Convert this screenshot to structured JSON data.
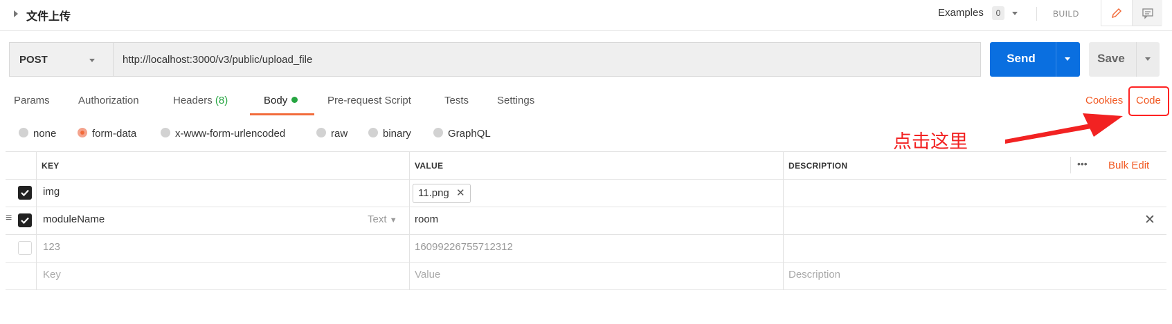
{
  "header": {
    "title": "文件上传",
    "examples_label": "Examples",
    "examples_count": "0",
    "build_label": "BUILD",
    "mode_icons": [
      "pencil-icon",
      "comment-icon"
    ]
  },
  "request": {
    "method": "POST",
    "url": "http://localhost:3000/v3/public/upload_file",
    "send_label": "Send",
    "save_label": "Save"
  },
  "tabs": [
    {
      "label": "Params"
    },
    {
      "label": "Authorization"
    },
    {
      "label": "Headers ",
      "count": "(8)"
    },
    {
      "label": "Body",
      "active": true
    },
    {
      "label": "Pre-request Script"
    },
    {
      "label": "Tests"
    },
    {
      "label": "Settings"
    }
  ],
  "right_links": {
    "cookies": "Cookies",
    "code": "Code"
  },
  "body_types": [
    {
      "label": "none",
      "selected": false
    },
    {
      "label": "form-data",
      "selected": true
    },
    {
      "label": "x-www-form-urlencoded",
      "selected": false
    },
    {
      "label": "raw",
      "selected": false
    },
    {
      "label": "binary",
      "selected": false
    },
    {
      "label": "GraphQL",
      "selected": false
    }
  ],
  "annotation": "点击这里",
  "table": {
    "columns": {
      "key": "KEY",
      "value": "VALUE",
      "description": "DESCRIPTION"
    },
    "bulk_edit": "Bulk Edit",
    "more_label": "•••",
    "rows": [
      {
        "checked": true,
        "key": "img",
        "value": "11.png",
        "value_is_file": true,
        "description": ""
      },
      {
        "checked": true,
        "key": "moduleName",
        "type": "Text",
        "value": "room",
        "description": ""
      },
      {
        "checked": false,
        "key": "123",
        "value": "16099226755712312",
        "description": ""
      }
    ],
    "placeholders": {
      "key": "Key",
      "value": "Value",
      "description": "Description"
    }
  },
  "colors": {
    "accent": "#f26b3a",
    "send_blue": "#0a6fe0",
    "annotation_red": "#f22222",
    "active_green": "#26a541"
  }
}
